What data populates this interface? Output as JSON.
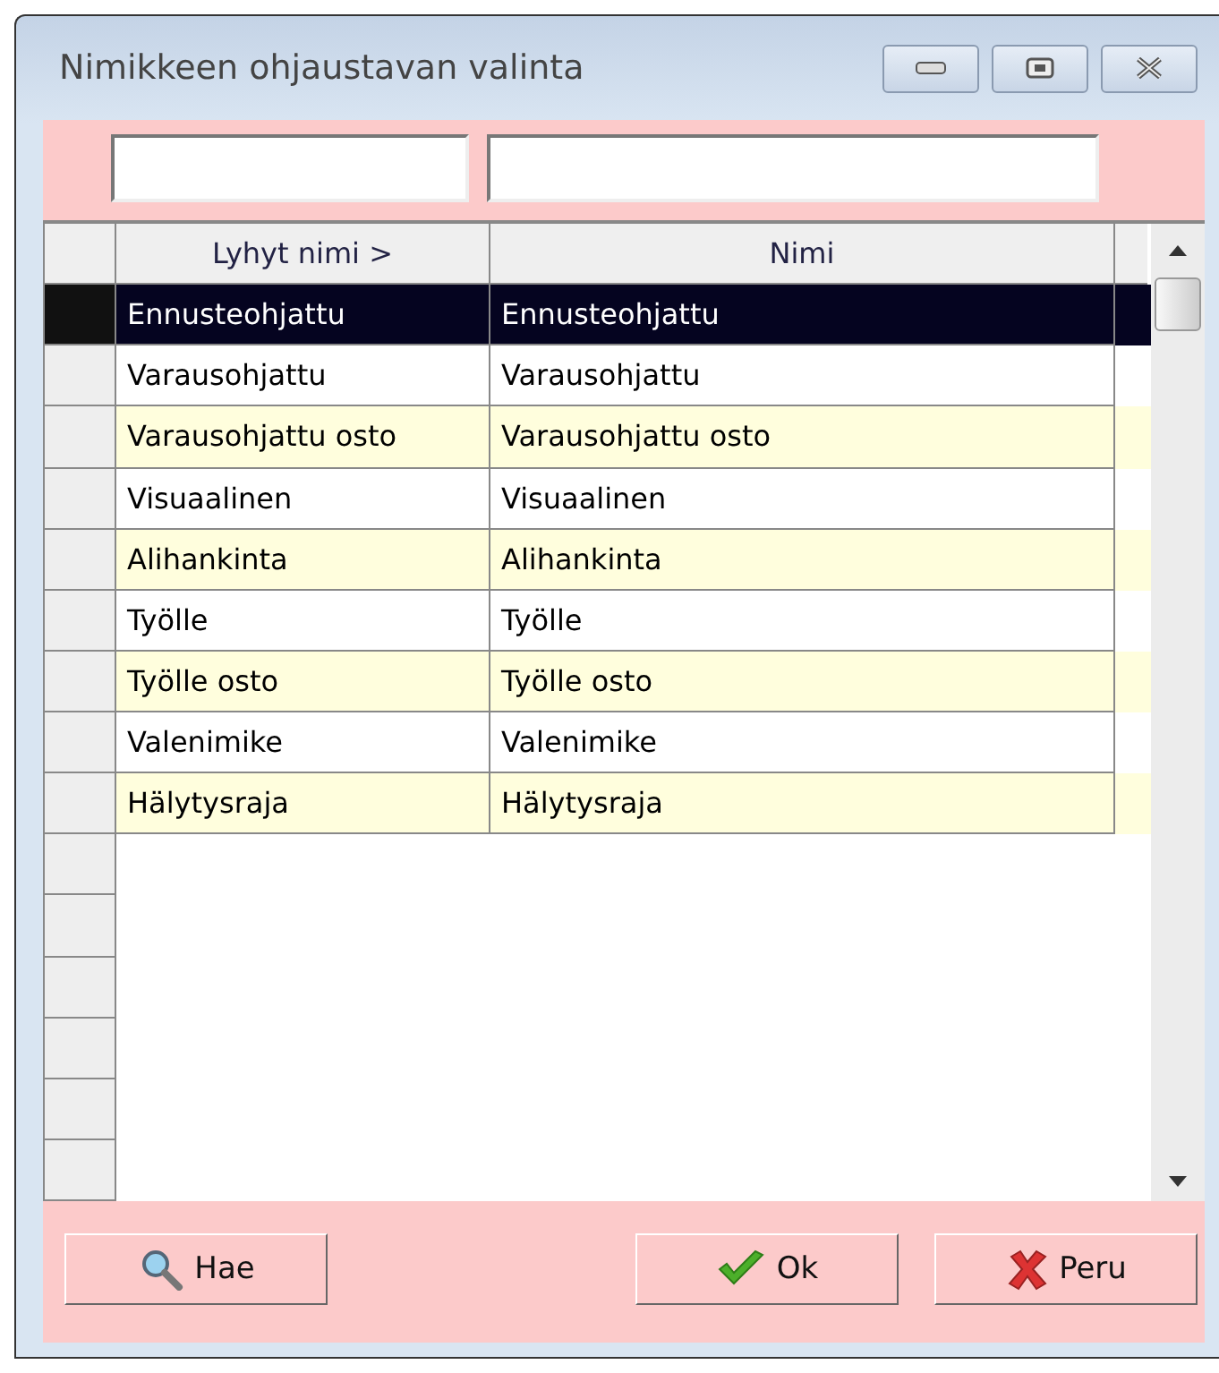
{
  "window": {
    "title": "Nimikkeen ohjaustavan valinta"
  },
  "table": {
    "columns": [
      {
        "label": "Lyhyt nimi  >"
      },
      {
        "label": "Nimi"
      }
    ],
    "rows": [
      {
        "short": "Ennusteohjattu",
        "name": "Ennusteohjattu",
        "selected": true
      },
      {
        "short": "Varausohjattu",
        "name": "Varausohjattu",
        "selected": false
      },
      {
        "short": "Varausohjattu osto",
        "name": "Varausohjattu osto",
        "selected": false
      },
      {
        "short": "Visuaalinen",
        "name": "Visuaalinen",
        "selected": false
      },
      {
        "short": "Alihankinta",
        "name": "Alihankinta",
        "selected": false
      },
      {
        "short": "Työlle",
        "name": "Työlle",
        "selected": false
      },
      {
        "short": "Työlle osto",
        "name": "Työlle osto",
        "selected": false
      },
      {
        "short": "Valenimike",
        "name": "Valenimike",
        "selected": false
      },
      {
        "short": "Hälytysraja",
        "name": "Hälytysraja",
        "selected": false
      }
    ]
  },
  "buttons": [
    {
      "kind": "search",
      "label": "Hae"
    },
    {
      "kind": "ok",
      "label": "Ok"
    },
    {
      "kind": "cancel",
      "label": "Peru"
    }
  ]
}
